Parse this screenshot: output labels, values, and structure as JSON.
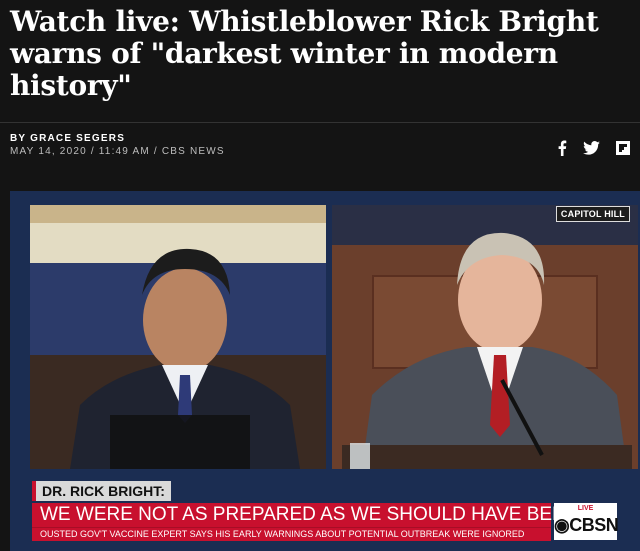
{
  "article": {
    "title": "Watch live: Whistleblower Rick Bright warns of \"darkest winter in modern history\"",
    "byline": "BY GRACE SEGERS",
    "meta": "MAY 14, 2020 / 11:49 AM / CBS NEWS"
  },
  "share": {
    "icons": [
      "facebook-icon",
      "twitter-icon",
      "flipboard-icon"
    ]
  },
  "video": {
    "location_tag": "CAPITOL HILL",
    "chyron": {
      "name": "DR. RICK BRIGHT:",
      "headline": "WE WERE NOT AS PREPARED AS WE SHOULD HAVE BEEN",
      "subline": "OUSTED GOV'T VACCINE EXPERT SAYS HIS EARLY WARNINGS ABOUT POTENTIAL OUTBREAK WERE IGNORED"
    },
    "network": {
      "live_label": "LIVE",
      "logo_text": "CBSN"
    }
  },
  "colors": {
    "background": "#141414",
    "chyron_red": "#c8102e",
    "name_bar": "#d9d9d9"
  }
}
